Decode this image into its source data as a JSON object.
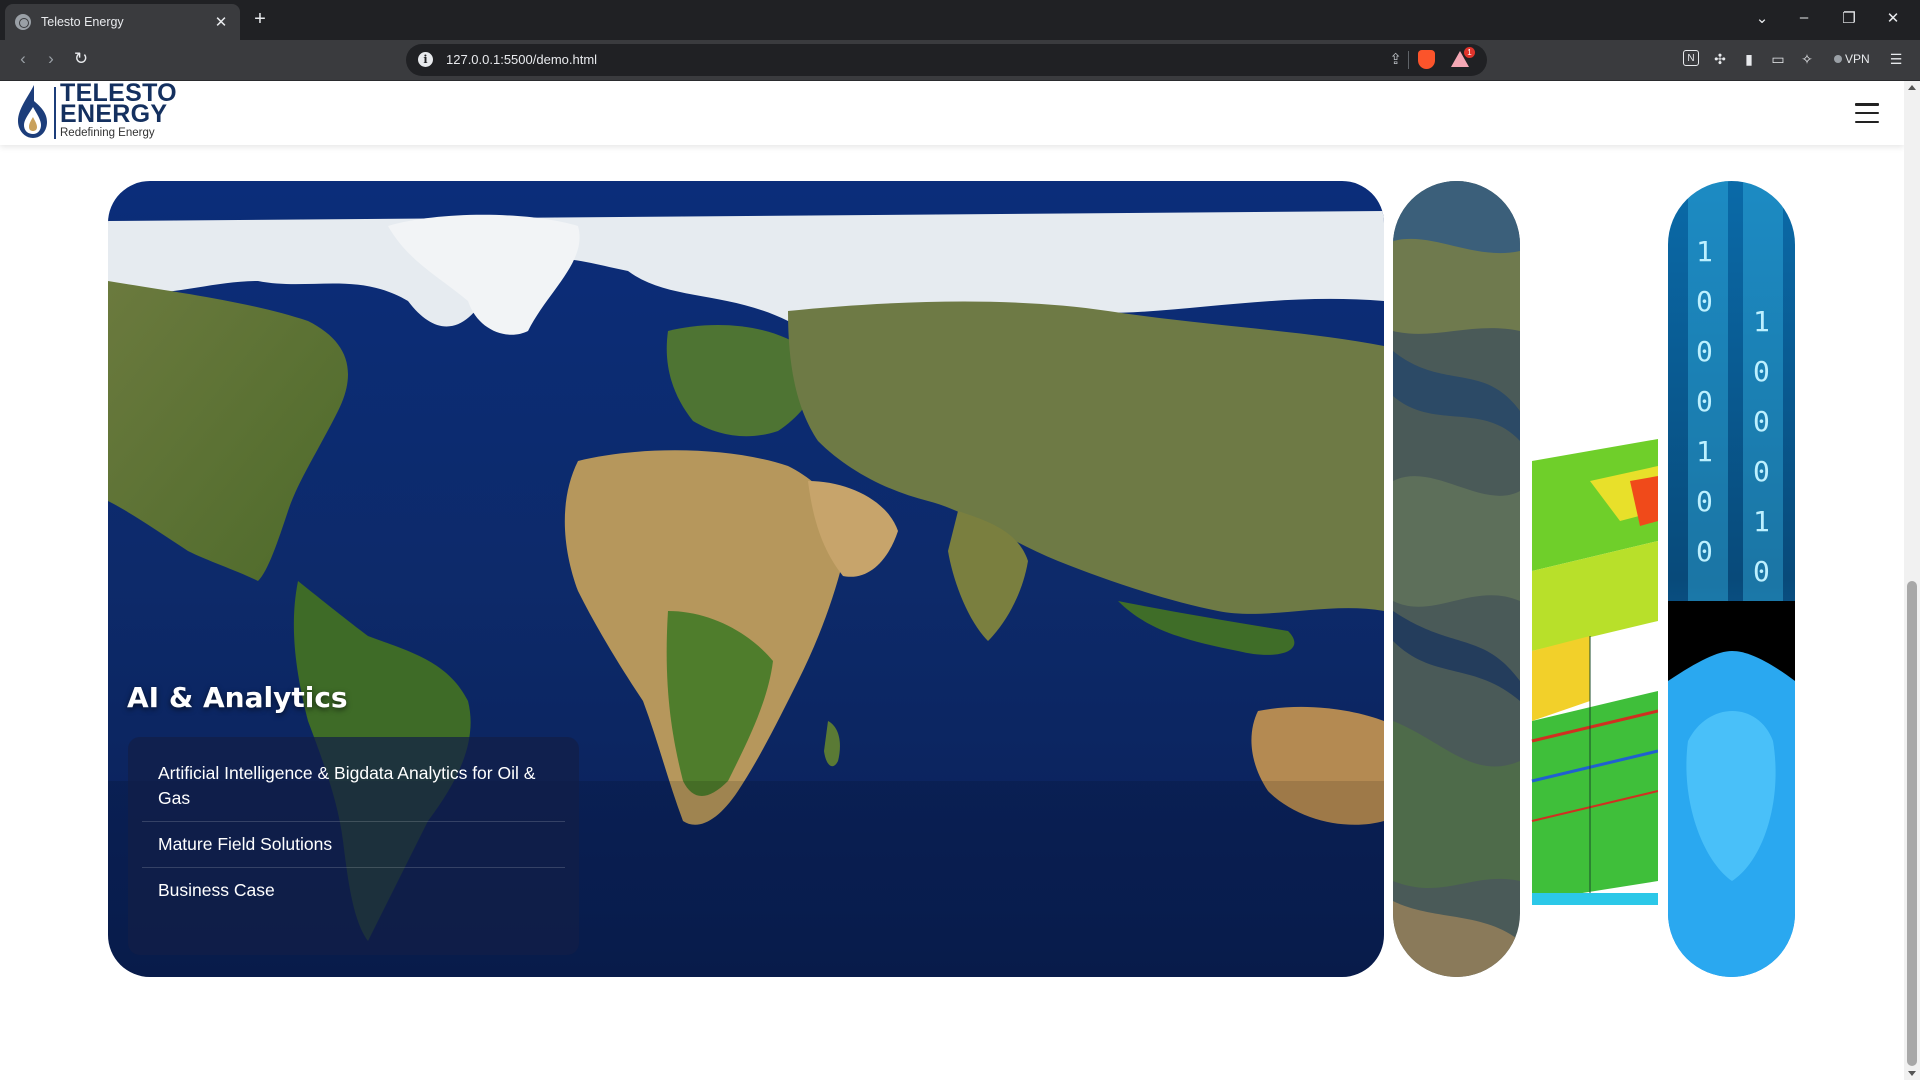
{
  "browser": {
    "tab_title": "Telesto Energy",
    "tab_close": "✕",
    "new_tab": "+",
    "url": "127.0.0.1:5500/demo.html",
    "vpn_label": "VPN",
    "rewards_count": "1",
    "window_controls": [
      "⌄",
      "–",
      "❐",
      "✕"
    ],
    "nav": {
      "back": "‹",
      "forward": "›",
      "reload": "↻"
    }
  },
  "site": {
    "logo_line1": "TELESTO",
    "logo_line2": "ENERGY",
    "logo_tagline": "Redefining Energy"
  },
  "carousel": {
    "active": {
      "title": "AI & Analytics",
      "items": [
        "Artificial Intelligence & Bigdata Analytics for Oil & Gas",
        "Mature Field Solutions",
        "Business Case"
      ]
    }
  },
  "colors": {
    "ocean": "#0d2a6a",
    "brand_blue": "#14305f",
    "card_bg": "rgba(18,30,70,0.72)"
  }
}
